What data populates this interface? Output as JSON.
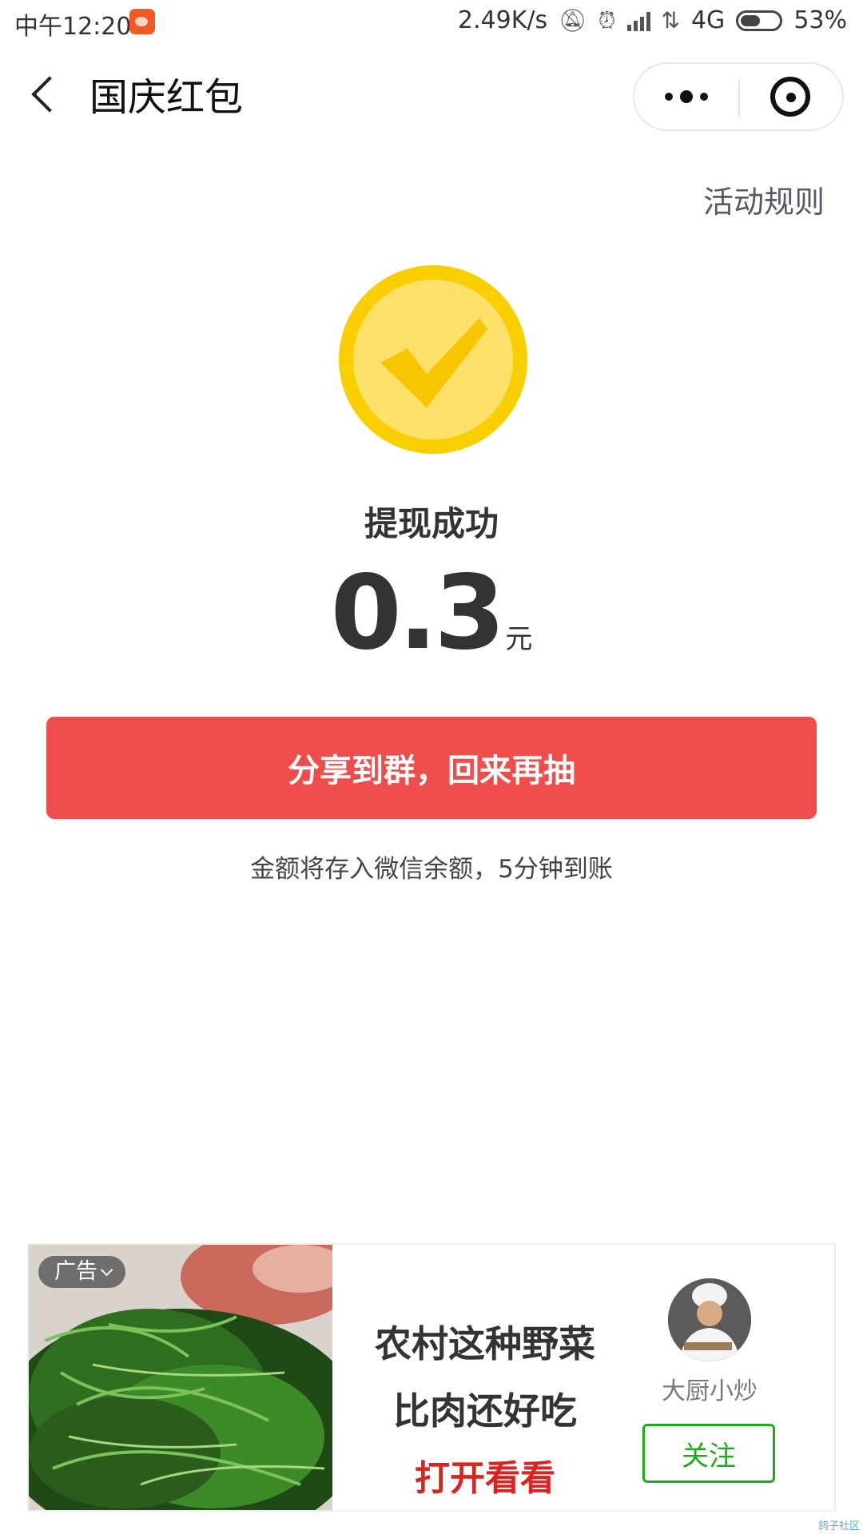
{
  "status_bar": {
    "time": "中午12:20",
    "net_speed": "2.49K/s",
    "network": "4G",
    "battery_percent": "53%",
    "battery_level": 0.53
  },
  "nav": {
    "title": "国庆红包",
    "more_icon": "more-dots-icon",
    "close_icon": "target-close-icon"
  },
  "rules_link": "活动规则",
  "result": {
    "icon": "check-circle-icon",
    "title": "提现成功",
    "amount": "0.3",
    "unit": "元"
  },
  "share_button": "分享到群，回来再抽",
  "hint": "金额将存入微信余额，5分钟到账",
  "ad": {
    "tag": "广告",
    "line1": "农村这种野菜",
    "line2": "比肉还好吃",
    "cta": "打开看看",
    "author": "大厨小炒",
    "follow": "关注"
  },
  "watermark": "鸽子社区",
  "colors": {
    "accent_red": "#ef4c4c",
    "coin_yellow": "#f9cf00",
    "follow_green": "#1aad19"
  }
}
